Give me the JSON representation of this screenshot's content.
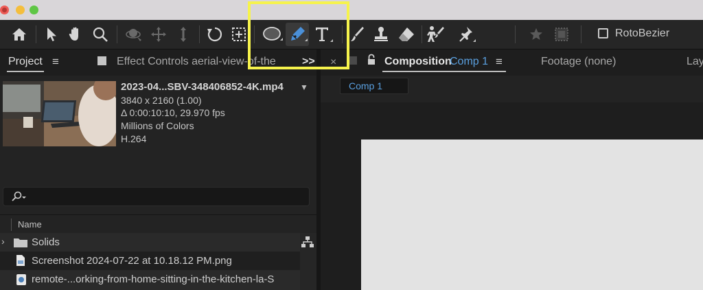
{
  "toolbar": {
    "tools": [
      "home-icon",
      "selection-arrow-icon",
      "hand-icon",
      "zoom-icon",
      "orbit-icon",
      "pan-icon",
      "dolly-icon",
      "rotate-icon",
      "pan-behind-icon",
      "ellipse-icon",
      "pen-icon",
      "type-icon",
      "brush-icon",
      "clone-stamp-icon",
      "eraser-icon",
      "roto-brush-icon",
      "puppet-pin-icon",
      "star-icon",
      "snapping-icon"
    ],
    "rotobezier_label": "RotoBezier"
  },
  "project_panel": {
    "tab_label": "Project",
    "effect_controls_label": "Effect Controls aerial-view-of-the",
    "more_label": ">>",
    "footage": {
      "name": "2023-04...SBV-348406852-4K.mp4",
      "resolution": "3840 x 2160 (1.00)",
      "duration": "Δ 0:00:10:10, 29.970 fps",
      "colors": "Millions of Colors",
      "codec": "H.264"
    },
    "search_placeholder": "",
    "column_name": "Name",
    "items": [
      {
        "label": "Solids",
        "type": "folder"
      },
      {
        "label": "Screenshot 2024-07-22 at 10.18.12 PM.png",
        "type": "image"
      },
      {
        "label": "remote-...orking-from-home-sitting-in-the-kitchen-la-S",
        "type": "video"
      }
    ]
  },
  "composition_panel": {
    "close_label": "×",
    "tab_label": "Composition",
    "comp_name": "Comp 1",
    "footage_label": "Footage (none)",
    "layer_label": "Lay",
    "subtab_label": "Comp 1"
  },
  "colors": {
    "highlight": "#f6f34c",
    "accent_blue": "#5aa0e0",
    "pen_active": "#4a90d9"
  }
}
